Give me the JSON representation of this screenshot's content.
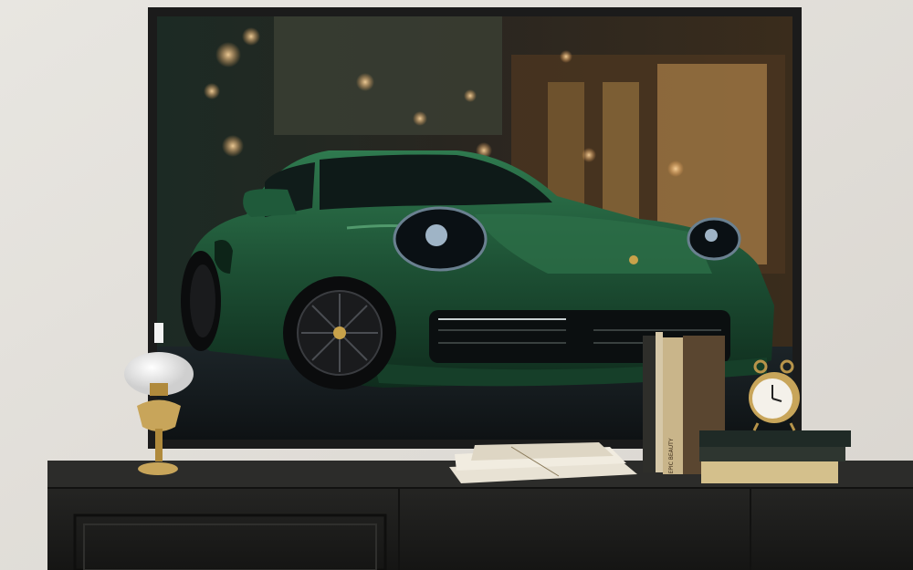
{
  "scene": {
    "subject": "framed-car-art-print",
    "colors": {
      "wall": "#e4e1dc",
      "frame": "#1b1b1b",
      "car_body": "#1f5a3a",
      "car_highlight": "#4f9a6c",
      "dresser": "#1e1e1c",
      "book_tan": "#c9b58a",
      "clock_brass": "#c8a55a"
    },
    "books_spine_text": "EPIC BEAUTY"
  }
}
